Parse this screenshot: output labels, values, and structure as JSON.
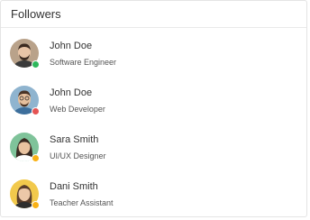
{
  "header": {
    "title": "Followers"
  },
  "followers": [
    {
      "name": "John Doe",
      "role": "Software Engineer",
      "status": "online",
      "status_color": "#2eb85c",
      "avatar_bg": "#b9a28a",
      "skin": "#e8c4a6",
      "hair": "#3b2a20",
      "shirt": "#3b3b3b"
    },
    {
      "name": "John Doe",
      "role": "Web Developer",
      "status": "busy",
      "status_color": "#e55353",
      "avatar_bg": "#8fb4cf",
      "skin": "#e6bf9c",
      "hair": "#4a3426",
      "shirt": "#3d6f9c"
    },
    {
      "name": "Sara Smith",
      "role": "UI/UX Designer",
      "status": "away",
      "status_color": "#f9b115",
      "avatar_bg": "#7fc39a",
      "skin": "#e9c3a0",
      "hair": "#3a2a22",
      "shirt": "#ffffff"
    },
    {
      "name": "Dani Smith",
      "role": "Teacher Assistant",
      "status": "away",
      "status_color": "#f9b115",
      "avatar_bg": "#f2c94c",
      "skin": "#ecc8a8",
      "hair": "#5a3d2a",
      "shirt": "#2e2e2e"
    }
  ]
}
